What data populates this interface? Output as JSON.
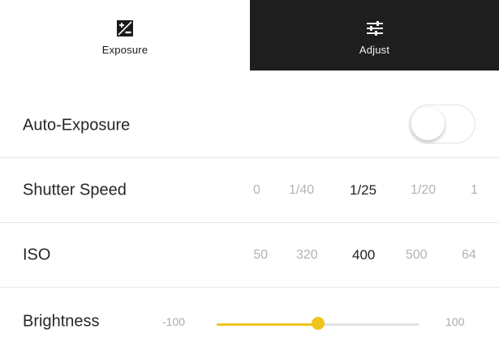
{
  "tabs": [
    {
      "label": "Exposure",
      "icon": "exposure-icon",
      "active": true
    },
    {
      "label": "Adjust",
      "icon": "sliders-icon",
      "active": false
    }
  ],
  "auto_exposure": {
    "label": "Auto-Exposure",
    "enabled": false
  },
  "shutter_speed": {
    "label": "Shutter Speed",
    "options": [
      "0",
      "1/40",
      "1/25",
      "1/20",
      "1"
    ],
    "selected": "1/25"
  },
  "iso": {
    "label": "ISO",
    "options": [
      "50",
      "320",
      "400",
      "500",
      "64"
    ],
    "selected": "400"
  },
  "brightness": {
    "label": "Brightness",
    "min_label": "-100",
    "max_label": "100",
    "min": -100,
    "max": 100,
    "value": 0
  },
  "colors": {
    "accent": "#f0c419",
    "tab_active_bg": "#ffffff",
    "tab_inactive_bg": "#1e1e1e"
  }
}
